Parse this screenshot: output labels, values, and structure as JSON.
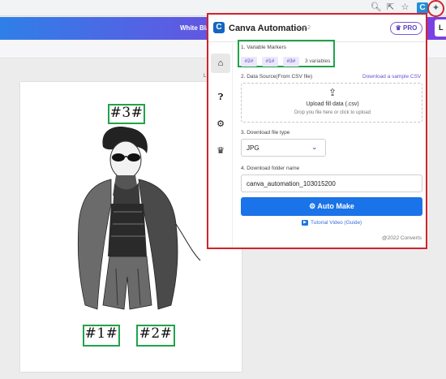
{
  "browser": {
    "icons": [
      "search-icon",
      "share-icon",
      "star-icon",
      "extension-icon",
      "puzzle-icon"
    ]
  },
  "canva": {
    "topbar_text": "White Bla",
    "topbar_button": "L",
    "page_corner_text": "L"
  },
  "canvas": {
    "markers": [
      "#3#",
      "#1#",
      "#2#"
    ]
  },
  "popup": {
    "title": "Canva Automation",
    "version": "v1.0.2",
    "pro_label": "PRO",
    "nav": [
      "home-icon",
      "help-icon",
      "settings-icon",
      "crown-icon"
    ],
    "variable_markers": {
      "label": "1. Variable Markers",
      "chips": [
        "#2#",
        "#1#",
        "#3#"
      ],
      "count": "3 variables"
    },
    "data_source": {
      "label": "2. Data Source(From CSV file)",
      "sample_link": "Download a sample CSV",
      "upload_title": "Upload fill data (.csv)",
      "upload_sub": "Drop you file here or click to upload"
    },
    "file_type": {
      "label": "3. Download file type",
      "value": "JPG"
    },
    "folder": {
      "label": "4. Download folder name",
      "value": "canva_automation_103015200"
    },
    "auto_make_label": "Auto Make",
    "tutorial_label": "Tutorial Video (Guide)",
    "copyright": "@2022 Converts"
  }
}
